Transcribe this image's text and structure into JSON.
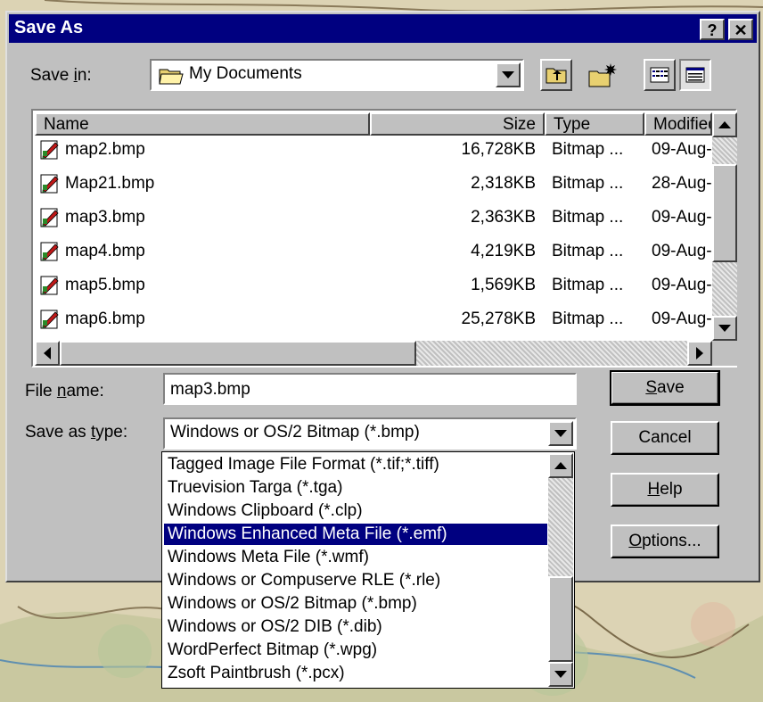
{
  "window": {
    "title": "Save As",
    "help_glyph": "?",
    "close_glyph": "✕"
  },
  "save_in": {
    "label_pre": "Save ",
    "label_accel": "i",
    "label_post": "n:",
    "value": "My Documents"
  },
  "toolbar": {
    "icons": [
      "up-one-level-icon",
      "create-new-folder-icon",
      "list-view-icon",
      "details-view-icon"
    ]
  },
  "file_list": {
    "columns": {
      "name": "Name",
      "size": "Size",
      "type": "Type",
      "modified": "Modified"
    },
    "rows": [
      {
        "name": "map2.bmp",
        "size": "16,728KB",
        "type": "Bitmap ...",
        "modified": "09-Aug-"
      },
      {
        "name": "Map21.bmp",
        "size": "2,318KB",
        "type": "Bitmap ...",
        "modified": "28-Aug-"
      },
      {
        "name": "map3.bmp",
        "size": "2,363KB",
        "type": "Bitmap ...",
        "modified": "09-Aug-"
      },
      {
        "name": "map4.bmp",
        "size": "4,219KB",
        "type": "Bitmap ...",
        "modified": "09-Aug-"
      },
      {
        "name": "map5.bmp",
        "size": "1,569KB",
        "type": "Bitmap ...",
        "modified": "09-Aug-"
      },
      {
        "name": "map6.bmp",
        "size": "25,278KB",
        "type": "Bitmap ...",
        "modified": "09-Aug-"
      }
    ]
  },
  "file_name": {
    "label_pre": "File ",
    "label_accel": "n",
    "label_post": "ame:",
    "value": "map3.bmp"
  },
  "save_as_type": {
    "label_pre": "Save as ",
    "label_accel": "t",
    "label_post": "ype:",
    "value": "Windows or OS/2 Bitmap (*.bmp)",
    "options": [
      "Tagged Image File Format (*.tif;*.tiff)",
      "Truevision Targa (*.tga)",
      "Windows Clipboard (*.clp)",
      "Windows Enhanced Meta File (*.emf)",
      "Windows Meta File (*.wmf)",
      "Windows or Compuserve RLE (*.rle)",
      "Windows or OS/2 Bitmap (*.bmp)",
      "Windows or OS/2 DIB (*.dib)",
      "WordPerfect Bitmap (*.wpg)",
      "Zsoft Paintbrush (*.pcx)"
    ],
    "highlighted": "Windows Enhanced Meta File (*.emf)"
  },
  "buttons": {
    "save": {
      "accel": "S",
      "rest": "ave"
    },
    "cancel": "Cancel",
    "help": {
      "accel": "H",
      "rest": "elp"
    },
    "options": {
      "accel": "O",
      "rest": "ptions..."
    }
  },
  "colors": {
    "title_bar": "#000080",
    "face": "#c0c0c0",
    "selection": "#000080"
  }
}
